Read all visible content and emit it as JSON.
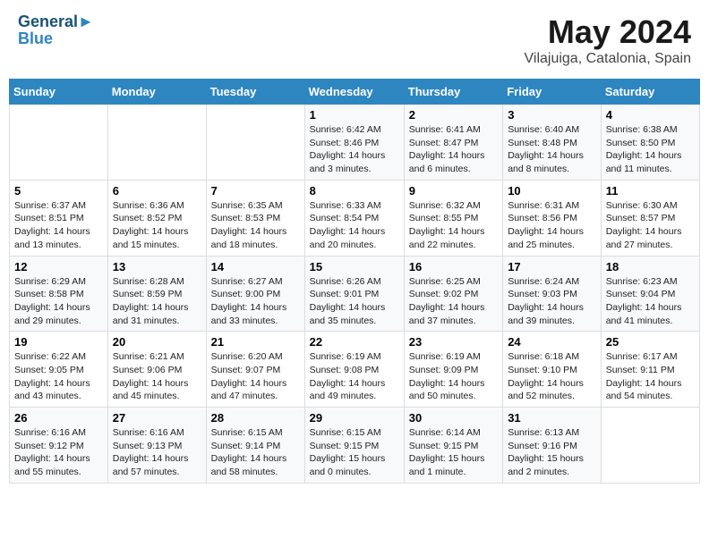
{
  "header": {
    "logo_line1": "General",
    "logo_line2": "Blue",
    "title": "May 2024",
    "subtitle": "Vilajuiga, Catalonia, Spain"
  },
  "days_of_week": [
    "Sunday",
    "Monday",
    "Tuesday",
    "Wednesday",
    "Thursday",
    "Friday",
    "Saturday"
  ],
  "weeks": [
    [
      {
        "day": "",
        "info": ""
      },
      {
        "day": "",
        "info": ""
      },
      {
        "day": "",
        "info": ""
      },
      {
        "day": "1",
        "info": "Sunrise: 6:42 AM\nSunset: 8:46 PM\nDaylight: 14 hours\nand 3 minutes."
      },
      {
        "day": "2",
        "info": "Sunrise: 6:41 AM\nSunset: 8:47 PM\nDaylight: 14 hours\nand 6 minutes."
      },
      {
        "day": "3",
        "info": "Sunrise: 6:40 AM\nSunset: 8:48 PM\nDaylight: 14 hours\nand 8 minutes."
      },
      {
        "day": "4",
        "info": "Sunrise: 6:38 AM\nSunset: 8:50 PM\nDaylight: 14 hours\nand 11 minutes."
      }
    ],
    [
      {
        "day": "5",
        "info": "Sunrise: 6:37 AM\nSunset: 8:51 PM\nDaylight: 14 hours\nand 13 minutes."
      },
      {
        "day": "6",
        "info": "Sunrise: 6:36 AM\nSunset: 8:52 PM\nDaylight: 14 hours\nand 15 minutes."
      },
      {
        "day": "7",
        "info": "Sunrise: 6:35 AM\nSunset: 8:53 PM\nDaylight: 14 hours\nand 18 minutes."
      },
      {
        "day": "8",
        "info": "Sunrise: 6:33 AM\nSunset: 8:54 PM\nDaylight: 14 hours\nand 20 minutes."
      },
      {
        "day": "9",
        "info": "Sunrise: 6:32 AM\nSunset: 8:55 PM\nDaylight: 14 hours\nand 22 minutes."
      },
      {
        "day": "10",
        "info": "Sunrise: 6:31 AM\nSunset: 8:56 PM\nDaylight: 14 hours\nand 25 minutes."
      },
      {
        "day": "11",
        "info": "Sunrise: 6:30 AM\nSunset: 8:57 PM\nDaylight: 14 hours\nand 27 minutes."
      }
    ],
    [
      {
        "day": "12",
        "info": "Sunrise: 6:29 AM\nSunset: 8:58 PM\nDaylight: 14 hours\nand 29 minutes."
      },
      {
        "day": "13",
        "info": "Sunrise: 6:28 AM\nSunset: 8:59 PM\nDaylight: 14 hours\nand 31 minutes."
      },
      {
        "day": "14",
        "info": "Sunrise: 6:27 AM\nSunset: 9:00 PM\nDaylight: 14 hours\nand 33 minutes."
      },
      {
        "day": "15",
        "info": "Sunrise: 6:26 AM\nSunset: 9:01 PM\nDaylight: 14 hours\nand 35 minutes."
      },
      {
        "day": "16",
        "info": "Sunrise: 6:25 AM\nSunset: 9:02 PM\nDaylight: 14 hours\nand 37 minutes."
      },
      {
        "day": "17",
        "info": "Sunrise: 6:24 AM\nSunset: 9:03 PM\nDaylight: 14 hours\nand 39 minutes."
      },
      {
        "day": "18",
        "info": "Sunrise: 6:23 AM\nSunset: 9:04 PM\nDaylight: 14 hours\nand 41 minutes."
      }
    ],
    [
      {
        "day": "19",
        "info": "Sunrise: 6:22 AM\nSunset: 9:05 PM\nDaylight: 14 hours\nand 43 minutes."
      },
      {
        "day": "20",
        "info": "Sunrise: 6:21 AM\nSunset: 9:06 PM\nDaylight: 14 hours\nand 45 minutes."
      },
      {
        "day": "21",
        "info": "Sunrise: 6:20 AM\nSunset: 9:07 PM\nDaylight: 14 hours\nand 47 minutes."
      },
      {
        "day": "22",
        "info": "Sunrise: 6:19 AM\nSunset: 9:08 PM\nDaylight: 14 hours\nand 49 minutes."
      },
      {
        "day": "23",
        "info": "Sunrise: 6:19 AM\nSunset: 9:09 PM\nDaylight: 14 hours\nand 50 minutes."
      },
      {
        "day": "24",
        "info": "Sunrise: 6:18 AM\nSunset: 9:10 PM\nDaylight: 14 hours\nand 52 minutes."
      },
      {
        "day": "25",
        "info": "Sunrise: 6:17 AM\nSunset: 9:11 PM\nDaylight: 14 hours\nand 54 minutes."
      }
    ],
    [
      {
        "day": "26",
        "info": "Sunrise: 6:16 AM\nSunset: 9:12 PM\nDaylight: 14 hours\nand 55 minutes."
      },
      {
        "day": "27",
        "info": "Sunrise: 6:16 AM\nSunset: 9:13 PM\nDaylight: 14 hours\nand 57 minutes."
      },
      {
        "day": "28",
        "info": "Sunrise: 6:15 AM\nSunset: 9:14 PM\nDaylight: 14 hours\nand 58 minutes."
      },
      {
        "day": "29",
        "info": "Sunrise: 6:15 AM\nSunset: 9:15 PM\nDaylight: 15 hours\nand 0 minutes."
      },
      {
        "day": "30",
        "info": "Sunrise: 6:14 AM\nSunset: 9:15 PM\nDaylight: 15 hours\nand 1 minute."
      },
      {
        "day": "31",
        "info": "Sunrise: 6:13 AM\nSunset: 9:16 PM\nDaylight: 15 hours\nand 2 minutes."
      },
      {
        "day": "",
        "info": ""
      }
    ]
  ]
}
